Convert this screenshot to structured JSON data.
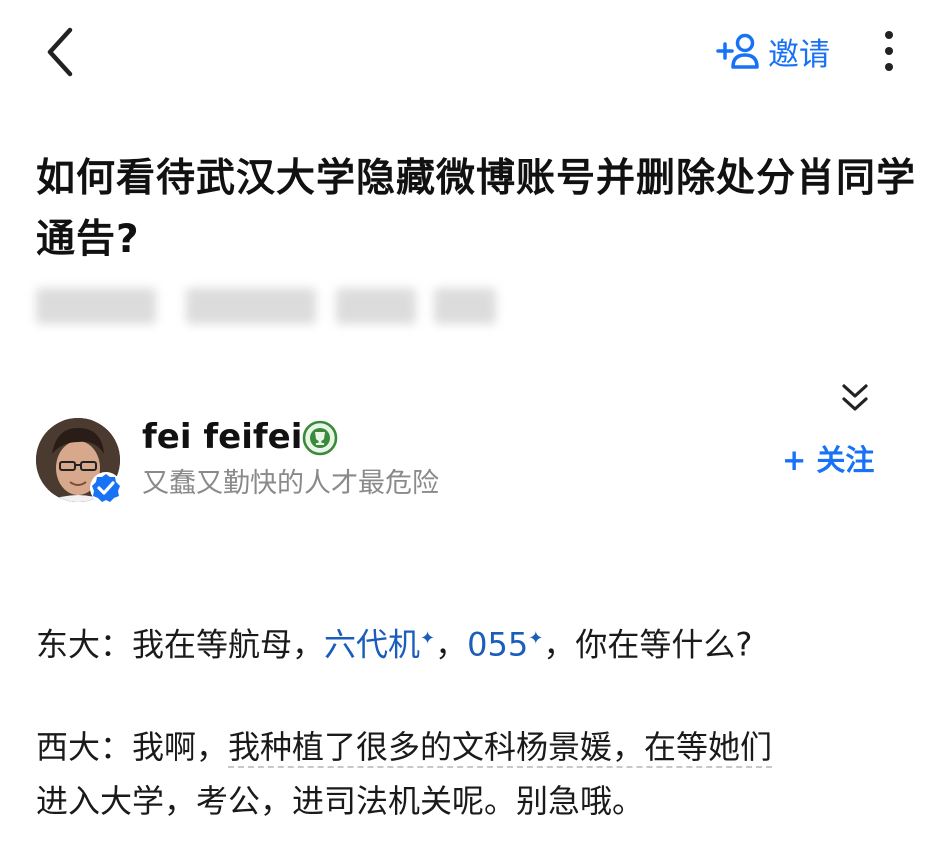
{
  "topbar": {
    "invite_label": "邀请"
  },
  "question": {
    "title": "如何看待武汉大学隐藏微博账号并删除处分肖同学通告?"
  },
  "author": {
    "name": "fei feifei",
    "bio": "又蠢又勤快的人才最危险",
    "follow_label": "+ 关注"
  },
  "answer": {
    "p1": {
      "prefix": "东大：我在等航母，",
      "link1": "六代机",
      "sep": "，",
      "link2": "055",
      "suffix": "，你在等什么?"
    },
    "p2": {
      "line1_plain": "西大：我啊，",
      "line1_dotted": "我种植了很多的文科杨景媛，在等她们",
      "line2": "进入大学，考公，进司法机关呢。别急哦。"
    }
  },
  "colors": {
    "accent": "#1772f6",
    "link": "#1a5dbb",
    "muted": "#8a8a8a"
  }
}
